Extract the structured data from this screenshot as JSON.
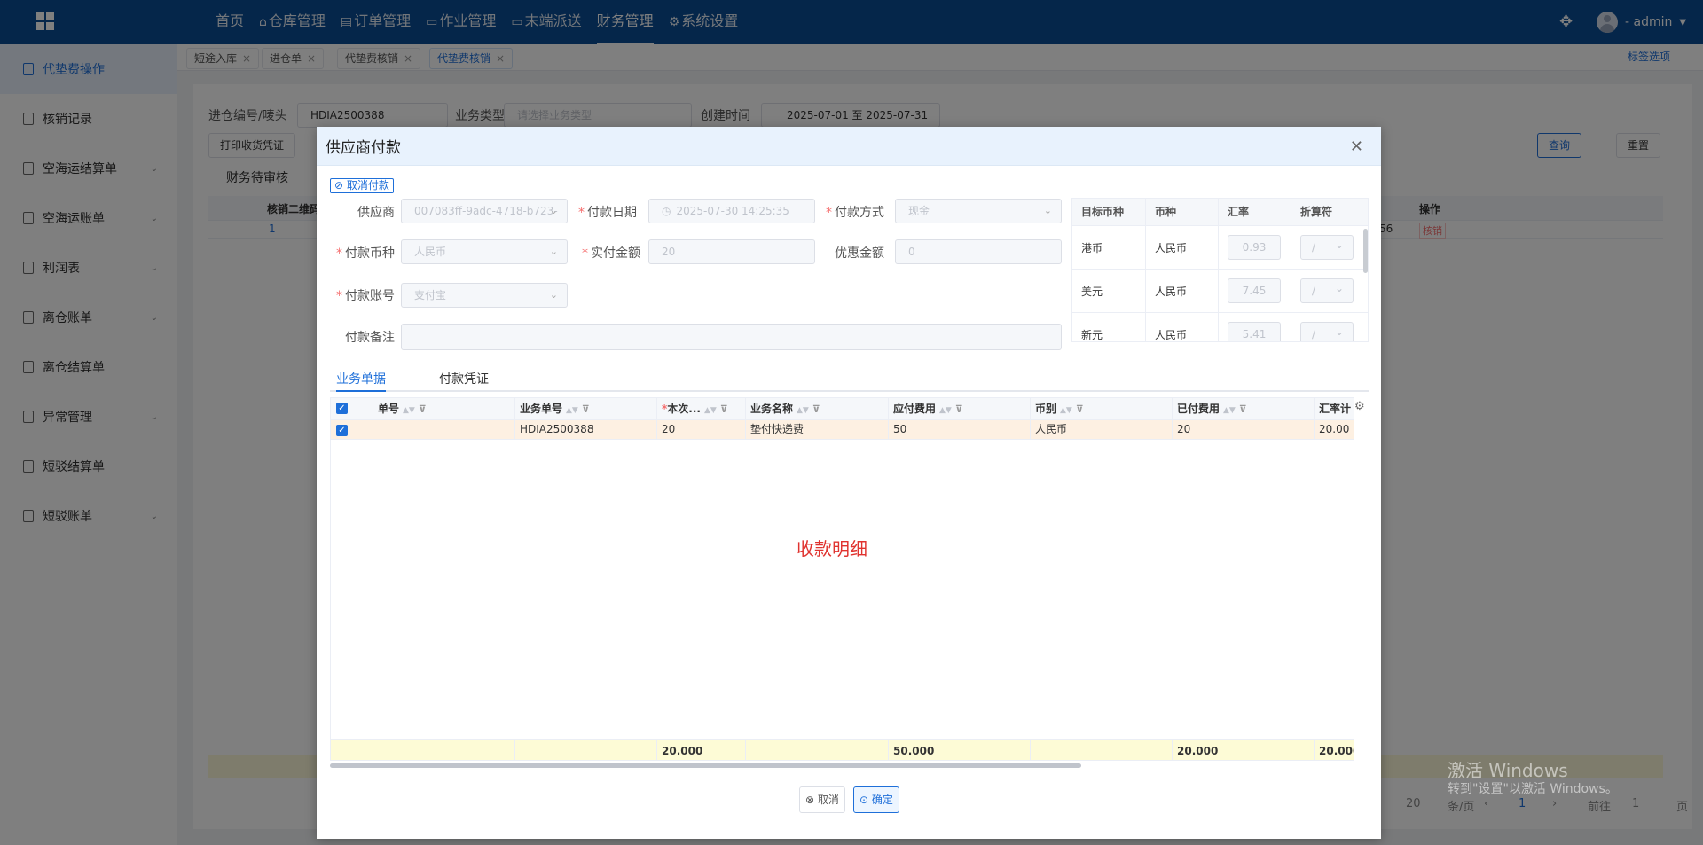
{
  "topnav": {
    "menu": [
      {
        "label": "首页",
        "icon": ""
      },
      {
        "label": "仓库管理",
        "icon": "⌂"
      },
      {
        "label": "订单管理",
        "icon": "▤"
      },
      {
        "label": "作业管理",
        "icon": "▭"
      },
      {
        "label": "末端派送",
        "icon": "▭"
      },
      {
        "label": "财务管理",
        "icon": ""
      },
      {
        "label": "系统设置",
        "icon": "⚙"
      }
    ],
    "active_index": 5,
    "user": "- admin"
  },
  "sidebar": {
    "items": [
      {
        "label": "代垫费操作",
        "has_children": false
      },
      {
        "label": "核销记录",
        "has_children": false
      },
      {
        "label": "空海运结算单",
        "has_children": true
      },
      {
        "label": "空海运账单",
        "has_children": true
      },
      {
        "label": "利润表",
        "has_children": true
      },
      {
        "label": "离仓账单",
        "has_children": true
      },
      {
        "label": "离仓结算单",
        "has_children": false
      },
      {
        "label": "异常管理",
        "has_children": true
      },
      {
        "label": "短驳结算单",
        "has_children": false
      },
      {
        "label": "短驳账单",
        "has_children": true
      }
    ],
    "active_index": 0
  },
  "page_tabs": {
    "items": [
      "短途入库",
      "进仓单",
      "代垫费核销",
      "代垫费核销"
    ],
    "active_index": 3,
    "options_label": "标签选项"
  },
  "background_page": {
    "filter_label_1": "进仓编号/唛头",
    "filter_value_1": "HDIA2500388",
    "filter_label_2": "业务类型",
    "filter_placeholder_2": "请选择业务类型",
    "filter_label_3": "创建时间",
    "filter_value_3": "2025-07-01 至 2025-07-31",
    "print_label": "打印收货凭证",
    "query_label": "查询",
    "reset_label": "重置",
    "subtab_label": "财务待审核",
    "col_qrcode": "核销二维码",
    "col_action": "操作",
    "row_value": "1",
    "row_value_right": "56",
    "row_action": "核销",
    "pager_size": "20",
    "pager_size_unit": "条/页",
    "pager_current": "1",
    "goto_label": "前往",
    "goto_value": "1",
    "goto_unit": "页"
  },
  "watermark": {
    "line1": "激活 Windows",
    "line2": "转到\"设置\"以激活 Windows。"
  },
  "dialog": {
    "title": "供应商付款",
    "cancel_payment_label": "取消付款",
    "form": {
      "supplier_label": "供应商",
      "supplier_value": "007083ff-9adc-4718-b723-",
      "pay_date_label": "付款日期",
      "pay_date_value": "2025-07-30 14:25:35",
      "pay_method_label": "付款方式",
      "pay_method_value": "现金",
      "currency_label": "付款币种",
      "currency_value": "人民币",
      "actual_amount_label": "实付金额",
      "actual_amount_value": "20",
      "discount_label": "优惠金额",
      "discount_value": "0",
      "account_label": "付款账号",
      "account_value": "支付宝",
      "remark_label": "付款备注"
    },
    "rate_table": {
      "headers": [
        "目标币种",
        "币种",
        "汇率",
        "折算符"
      ],
      "rows": [
        {
          "target": "港币",
          "currency": "人民币",
          "rate": "0.93",
          "op": "/"
        },
        {
          "target": "美元",
          "currency": "人民币",
          "rate": "7.45",
          "op": "/"
        },
        {
          "target": "新元",
          "currency": "人民币",
          "rate": "5.41",
          "op": "/"
        }
      ]
    },
    "tabs": [
      "业务单据",
      "付款凭证"
    ],
    "active_tab": 0,
    "grid": {
      "columns": [
        "单号",
        "业务单号",
        "本次...",
        "业务名称",
        "应付费用",
        "币别",
        "已付费用",
        "汇率计"
      ],
      "rows": [
        {
          "no": "",
          "biz_no": "HDIA2500388",
          "current": "20",
          "biz_name": "垫付快递费",
          "payable": "50",
          "currency": "人民币",
          "paid": "20",
          "rate_calc": "20.00"
        }
      ],
      "summary": {
        "current": "20.000",
        "payable": "50.000",
        "paid": "20.000",
        "rate_calc": "20.000"
      }
    },
    "detail_label": "收款明细",
    "cancel_label": "取消",
    "confirm_label": "确定"
  }
}
